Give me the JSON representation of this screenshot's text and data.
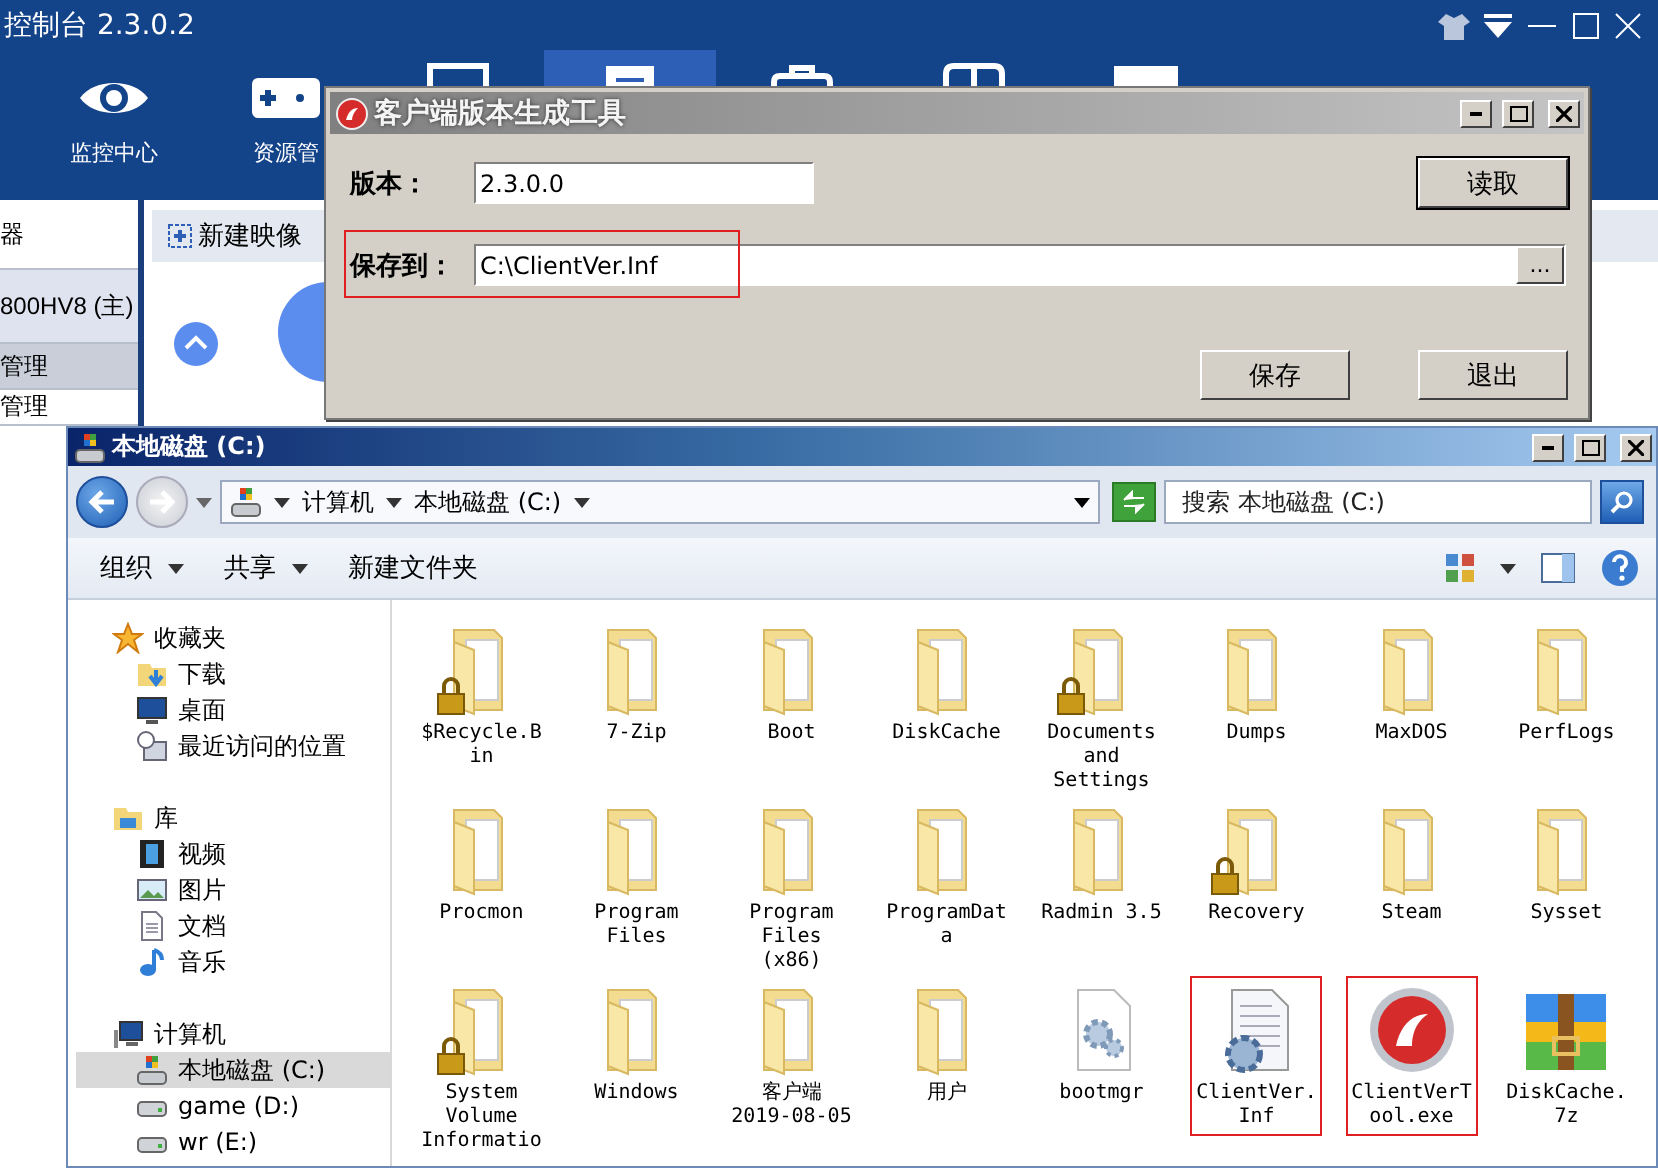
{
  "console": {
    "title": "控制台 2.3.0.2",
    "nav": [
      {
        "label": "监控中心",
        "selected": false
      },
      {
        "label": "资源管",
        "selected": false
      },
      {
        "selected": false
      },
      {
        "selected": true
      },
      {
        "selected": false
      },
      {
        "selected": false
      },
      {
        "selected": false
      }
    ],
    "left_items": [
      {
        "label": "器",
        "kind": "item",
        "selected": false
      },
      {
        "label": "800HV8 (主)",
        "kind": "item",
        "selected": true
      },
      {
        "label": "管理",
        "kind": "header",
        "selected": false
      },
      {
        "label": "管理",
        "kind": "item",
        "selected": false
      }
    ],
    "toolbar_button": "新建映像"
  },
  "dialog": {
    "title": "客户端版本生成工具",
    "fields": [
      {
        "label": "版本：",
        "value": "2.3.0.0"
      },
      {
        "label": "保存到：",
        "value": "C:\\ClientVer.Inf",
        "highlighted": true,
        "browse": "..."
      }
    ],
    "read_button": "读取",
    "buttons": [
      "保存",
      "退出"
    ]
  },
  "explorer": {
    "title": "本地磁盘 (C:)",
    "path": [
      "计算机",
      "本地磁盘 (C:)"
    ],
    "search": {
      "placeholder": "搜索 本地磁盘 (C:)"
    },
    "toolbar": [
      {
        "label": "组织",
        "dropdown": true
      },
      {
        "label": "共享",
        "dropdown": true
      },
      {
        "label": "新建文件夹",
        "dropdown": false
      }
    ],
    "sidebar": [
      {
        "label": "收藏夹",
        "selected": false,
        "children": [
          {
            "label": "下载",
            "selected": false
          },
          {
            "label": "桌面",
            "selected": false
          },
          {
            "label": "最近访问的位置",
            "selected": false
          }
        ]
      },
      {
        "label": "库",
        "selected": false,
        "children": [
          {
            "label": "视频",
            "selected": false
          },
          {
            "label": "图片",
            "selected": false
          },
          {
            "label": "文档",
            "selected": false
          },
          {
            "label": "音乐",
            "selected": false
          }
        ]
      },
      {
        "label": "计算机",
        "selected": false,
        "children": [
          {
            "label": "本地磁盘 (C:)",
            "selected": true
          },
          {
            "label": "game (D:)",
            "selected": false
          },
          {
            "label": "wr (E:)",
            "selected": false
          }
        ]
      }
    ],
    "files": [
      {
        "name": "$Recycle.Bin",
        "kind": "folder",
        "locked": true,
        "highlighted": false
      },
      {
        "name": "7-Zip",
        "kind": "folder",
        "locked": false,
        "highlighted": false
      },
      {
        "name": "Boot",
        "kind": "folder",
        "locked": false,
        "highlighted": false
      },
      {
        "name": "DiskCache",
        "kind": "folder",
        "locked": false,
        "highlighted": false
      },
      {
        "name": "Documents and Settings",
        "kind": "folder",
        "locked": true,
        "highlighted": false
      },
      {
        "name": "Dumps",
        "kind": "folder",
        "locked": false,
        "highlighted": false
      },
      {
        "name": "MaxDOS",
        "kind": "folder",
        "locked": false,
        "highlighted": false
      },
      {
        "name": "PerfLogs",
        "kind": "folder",
        "locked": false,
        "highlighted": false
      },
      {
        "name": "Procmon",
        "kind": "folder",
        "locked": false,
        "highlighted": false
      },
      {
        "name": "Program Files",
        "kind": "folder",
        "locked": false,
        "highlighted": false
      },
      {
        "name": "Program Files (x86)",
        "kind": "folder",
        "locked": false,
        "highlighted": false
      },
      {
        "name": "ProgramData",
        "kind": "folder",
        "locked": false,
        "highlighted": false
      },
      {
        "name": "Radmin 3.5",
        "kind": "folder",
        "locked": false,
        "highlighted": false
      },
      {
        "name": "Recovery",
        "kind": "folder",
        "locked": true,
        "highlighted": false
      },
      {
        "name": "Steam",
        "kind": "folder",
        "locked": false,
        "highlighted": false
      },
      {
        "name": "Sysset",
        "kind": "folder",
        "locked": false,
        "highlighted": false
      },
      {
        "name": "System Volume Informatio",
        "kind": "folder",
        "locked": true,
        "highlighted": false
      },
      {
        "name": "Windows",
        "kind": "folder",
        "locked": false,
        "highlighted": false
      },
      {
        "name": "客户端 2019-08-05",
        "kind": "folder",
        "locked": false,
        "highlighted": false
      },
      {
        "name": "用户",
        "kind": "folder",
        "locked": false,
        "highlighted": false
      },
      {
        "name": "bootmgr",
        "kind": "system-file",
        "highlighted": false
      },
      {
        "name": "ClientVer.Inf",
        "kind": "config-file",
        "highlighted": true
      },
      {
        "name": "ClientVerTool.exe",
        "kind": "app",
        "highlighted": true
      },
      {
        "name": "DiskCache.7z",
        "kind": "archive",
        "highlighted": false
      }
    ]
  }
}
